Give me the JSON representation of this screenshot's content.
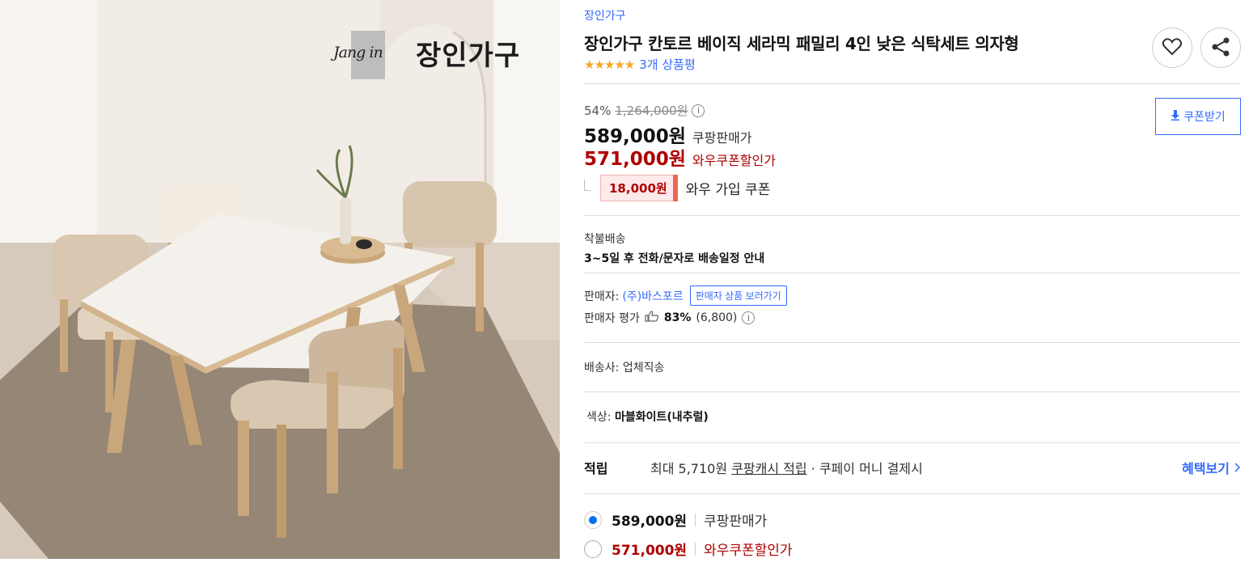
{
  "brand": {
    "script_logo": "Jang in",
    "name": "장인가구"
  },
  "product": {
    "breadcrumb": "장인가구",
    "title": "장인가구 칸토르 베이직 세라믹 패밀리 4인 낮은 식탁세트 의자형",
    "stars": "★★★★★",
    "rating_count": "3개 상품평"
  },
  "pricing": {
    "discount_rate": "54%",
    "original_price": "1,264,000원",
    "sale_price": "589,000원",
    "sale_label": "쿠팡판매가",
    "wow_price": "571,000원",
    "wow_label": "와우쿠폰할인가",
    "coupon_amount": "18,000원",
    "coupon_label": "와우 가입 쿠폰",
    "coupon_button": "쿠폰받기"
  },
  "shipping": {
    "type": "착불배송",
    "schedule": "3~5일 후 전화/문자로 배송일정 안내",
    "carrier_label": "배송사:",
    "carrier_value": "업체직송"
  },
  "seller": {
    "label": "판매자:",
    "name": "(주)바스포르",
    "shop_button": "판매자 상품 보러가기",
    "rating_label": "판매자 평가",
    "rating_percent": "83%",
    "rating_count": "(6,800)"
  },
  "option": {
    "color_label": "색상:",
    "color_value": "마블화이트(내추럴)"
  },
  "reward": {
    "label": "적립",
    "text_prefix": "최대 5,710원",
    "text_link": "쿠팡캐시 적립",
    "text_suffix": " · 쿠페이 머니 결제시",
    "benefit_link": "혜택보기"
  },
  "price_options": [
    {
      "price": "589,000원",
      "label": "쿠팡판매가",
      "selected": true
    },
    {
      "price": "571,000원",
      "label": "와우쿠폰할인가",
      "selected": false
    }
  ],
  "colors": {
    "link_blue": "#346aff",
    "price_red": "#ae0000",
    "star_orange": "#f5a623",
    "radio_blue": "#0073e9"
  },
  "icons": {
    "wishlist": "heart-icon",
    "share": "share-icon",
    "download": "download-icon",
    "info": "info-icon",
    "thumb": "thumbs-up-icon",
    "chevron": "chevron-right-icon"
  }
}
